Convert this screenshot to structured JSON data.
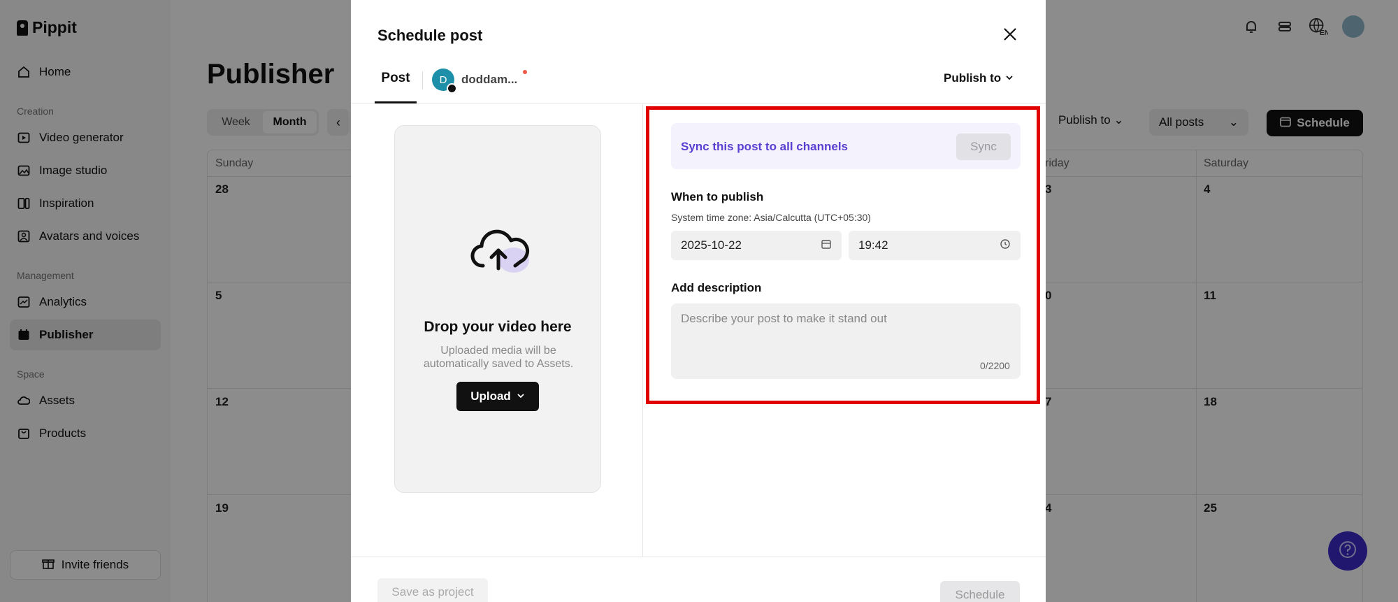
{
  "app": {
    "brand": "Pippit",
    "sidebar": {
      "items_top": [
        {
          "label": "Home",
          "icon": "home-icon"
        }
      ],
      "section_creation": "Creation",
      "creation_items": [
        {
          "label": "Video generator",
          "icon": "video-generator-icon"
        },
        {
          "label": "Image studio",
          "icon": "image-studio-icon"
        },
        {
          "label": "Inspiration",
          "icon": "inspiration-icon"
        },
        {
          "label": "Avatars and voices",
          "icon": "avatar-icon"
        }
      ],
      "section_management": "Management",
      "management_items": [
        {
          "label": "Analytics",
          "icon": "analytics-icon"
        },
        {
          "label": "Publisher",
          "icon": "calendar-icon"
        }
      ],
      "section_space": "Space",
      "space_items": [
        {
          "label": "Assets",
          "icon": "cloud-icon"
        },
        {
          "label": "Products",
          "icon": "bag-icon"
        }
      ],
      "invite": "Invite friends"
    },
    "page_title": "Publisher",
    "view_toggle": {
      "week": "Week",
      "month": "Month"
    },
    "publish_to": "Publish to",
    "all_posts": "All posts",
    "schedule": "Schedule",
    "calendar": {
      "headers": [
        "Sunday",
        "Friday",
        "Saturday"
      ],
      "headers_partial": [
        "riday"
      ],
      "sunday_nums": [
        "28",
        "5",
        "12",
        "19"
      ],
      "friday_nums": [
        "0",
        "7",
        "4"
      ],
      "saturday_nums": [
        "4",
        "11",
        "18",
        "25"
      ],
      "friday_prefix": [
        "3"
      ]
    },
    "language": "EN"
  },
  "modal": {
    "title": "Schedule post",
    "tab_post": "Post",
    "account_initial": "D",
    "account_name": "doddam...",
    "publish_to": "Publish to",
    "dropzone": {
      "title": "Drop your video here",
      "subtitle": "Uploaded media will be automatically saved to Assets.",
      "upload": "Upload"
    },
    "sync": {
      "text": "Sync this post to all channels",
      "button": "Sync"
    },
    "when": {
      "label": "When to publish",
      "timezone": "System time zone: Asia/Calcutta (UTC+05:30)",
      "date": "2025-10-22",
      "time": "19:42"
    },
    "description": {
      "label": "Add description",
      "placeholder": "Describe your post to make it stand out",
      "counter": "0/2200"
    },
    "footer": {
      "save_project": "Save as project",
      "schedule": "Schedule"
    }
  },
  "colors": {
    "sync_accent": "#5a3fd1",
    "highlight": "#e00000",
    "help_fab": "#3f2bc9"
  }
}
